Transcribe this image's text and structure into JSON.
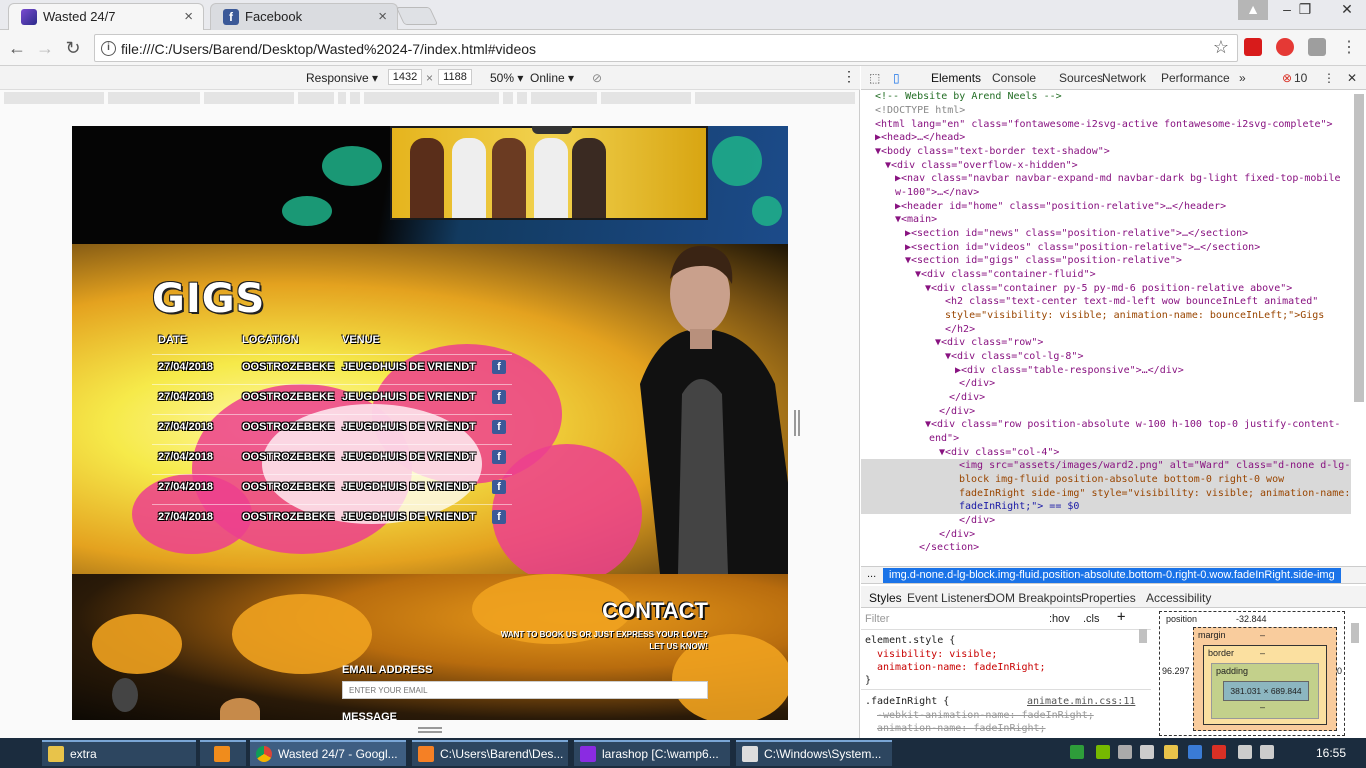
{
  "browser": {
    "tabs": [
      {
        "label": "Wasted 24/7",
        "icon": "wasted-favicon-icon"
      },
      {
        "label": "Facebook",
        "icon": "facebook-icon"
      }
    ],
    "url": "file:///C:/Users/Barend/Desktop/Wasted%2024-7/index.html#videos"
  },
  "device_toolbar": {
    "mode": "Responsive",
    "width": "1432",
    "height": "1188",
    "times": "×",
    "zoom": "50%",
    "network": "Online"
  },
  "site": {
    "gigs_title": "GIGS",
    "columns": [
      "DATE",
      "LOCATION",
      "VENUE"
    ],
    "gigs": [
      {
        "date": "27/04/2018",
        "location": "OOSTROZEBEKE",
        "venue": "JEUGDHUIS DE VRIENDT"
      },
      {
        "date": "27/04/2018",
        "location": "OOSTROZEBEKE",
        "venue": "JEUGDHUIS DE VRIENDT"
      },
      {
        "date": "27/04/2018",
        "location": "OOSTROZEBEKE",
        "venue": "JEUGDHUIS DE VRIENDT"
      },
      {
        "date": "27/04/2018",
        "location": "OOSTROZEBEKE",
        "venue": "JEUGDHUIS DE VRIENDT"
      },
      {
        "date": "27/04/2018",
        "location": "OOSTROZEBEKE",
        "venue": "JEUGDHUIS DE VRIENDT"
      },
      {
        "date": "27/04/2018",
        "location": "OOSTROZEBEKE",
        "venue": "JEUGDHUIS DE VRIENDT"
      }
    ],
    "contact_title": "CONTACT",
    "contact_sub1": "WANT TO BOOK US OR JUST EXPRESS YOUR LOVE?",
    "contact_sub2": "LET US KNOW!",
    "email_label": "EMAIL ADDRESS",
    "email_placeholder": "ENTER YOUR EMAIL",
    "message_label": "MESSAGE"
  },
  "devtools": {
    "tabs": [
      "Elements",
      "Console",
      "Sources",
      "Network",
      "Performance"
    ],
    "more": "»",
    "error_count": "10",
    "dom": [
      "<!-- Website by Arend Neels -->",
      "<!DOCTYPE html>",
      "<html lang=\"en\" class=\"fontawesome-i2svg-active fontawesome-i2svg-complete\">",
      "▶<head>…</head>",
      "▼<body class=\"text-border text-shadow\">",
      "▼<div class=\"overflow-x-hidden\">",
      "▶<nav class=\"navbar navbar-expand-md navbar-dark bg-light fixed-top-mobile",
      "w-100\">…</nav>",
      "▶<header id=\"home\" class=\"position-relative\">…</header>",
      "▼<main>",
      "▶<section id=\"news\" class=\"position-relative\">…</section>",
      "▶<section id=\"videos\" class=\"position-relative\">…</section>",
      "▼<section id=\"gigs\" class=\"position-relative\">",
      "▼<div class=\"container-fluid\">",
      "▼<div class=\"container py-5 py-md-6 position-relative above\">",
      "<h2 class=\"text-center text-md-left wow  bounceInLeft animated\"",
      "style=\"visibility: visible; animation-name: bounceInLeft;\">Gigs",
      "</h2>",
      "▼<div class=\"row\">",
      "▼<div class=\"col-lg-8\">",
      "▶<div class=\"table-responsive\">…</div>",
      "</div>",
      "</div>",
      "</div>",
      "▼<div class=\"row position-absolute w-100 h-100 top-0 justify-content-",
      "end\">",
      "▼<div class=\"col-4\">",
      "<img src=\"assets/images/ward2.png\" alt=\"Ward\" class=\"d-none d-lg-",
      "block img-fluid position-absolute bottom-0 right-0 wow",
      "fadeInRight side-img\" style=\"visibility: visible; animation-name:",
      "fadeInRight;\"> == $0",
      "</div>",
      "</div>",
      "</section>"
    ],
    "breadcrumb": "img.d-none.d-lg-block.img-fluid.position-absolute.bottom-0.right-0.wow.fadeInRight.side-img",
    "breadcrumb_more": "...",
    "styles_tabs": [
      "Styles",
      "Event Listeners",
      "DOM Breakpoints",
      "Properties",
      "Accessibility"
    ],
    "filter": "Filter",
    "hov": ":hov",
    "cls": ".cls",
    "styles": [
      "element.style {",
      "  visibility: visible;",
      "  animation-name: fadeInRight;",
      "}",
      ".fadeInRight {",
      "  -webkit-animation-name: fadeInRight;",
      "  animation-name: fadeInRight;"
    ],
    "styles_source": "animate.min.css:11",
    "box": {
      "label": "position",
      "top": "-32.844",
      "left": "96.297",
      "right": "0",
      "margin": "margin",
      "border": "border",
      "padding": "padding",
      "dash": "–",
      "content": "381.031 × 689.844"
    }
  },
  "taskbar": {
    "items": [
      "extra",
      "",
      "Wasted 24/7 - Googl...",
      "C:\\Users\\Barend\\Des...",
      "larashop [C:\\wamp6...",
      "C:\\Windows\\System..."
    ],
    "clock": "16:55"
  }
}
